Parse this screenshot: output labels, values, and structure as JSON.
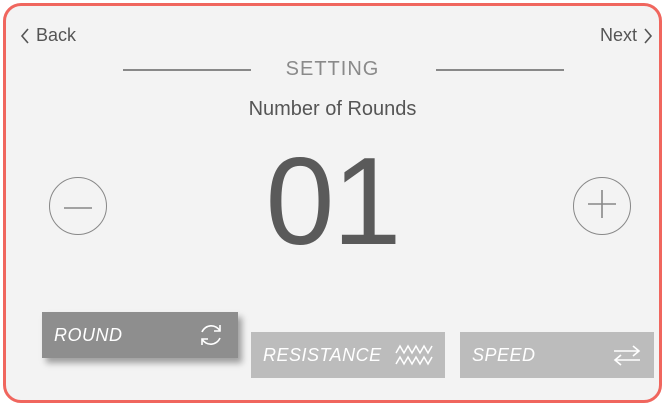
{
  "nav": {
    "back_label": "Back",
    "next_label": "Next"
  },
  "section": {
    "title": "SETTING",
    "subtitle": "Number of Rounds",
    "value": "01"
  },
  "modes": [
    {
      "label": "ROUND",
      "icon": "rotate-icon",
      "selected": true
    },
    {
      "label": "RESISTANCE",
      "icon": "zigzag-icon",
      "selected": false
    },
    {
      "label": "SPEED",
      "icon": "swap-arrows-icon",
      "selected": false
    }
  ],
  "colors": {
    "frame_border": "#f0665e",
    "background": "#f3f3f3",
    "selected_mode": "#8e8e8e",
    "unselected_mode": "#bcbcbc"
  }
}
